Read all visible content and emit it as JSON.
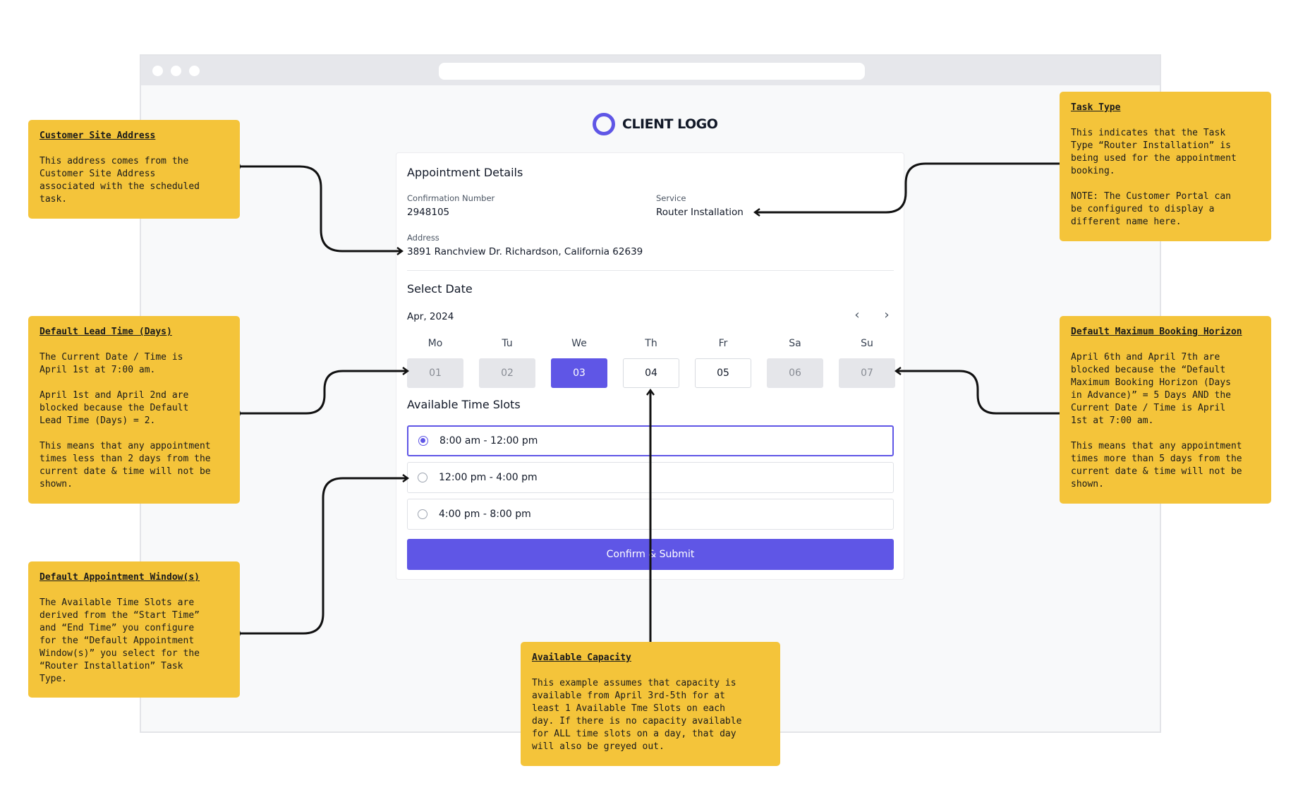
{
  "logo": {
    "text": "CLIENT LOGO",
    "accent": "#5f56e6"
  },
  "appointment": {
    "title": "Appointment Details",
    "confirmation_label": "Confirmation Number",
    "confirmation_value": "2948105",
    "service_label": "Service",
    "service_value": "Router Installation",
    "address_label": "Address",
    "address_value": "3891 Ranchview Dr. Richardson, California 62639"
  },
  "date_picker": {
    "title": "Select Date",
    "month": "Apr, 2024",
    "prev_icon": "chevron-left-icon",
    "next_icon": "chevron-right-icon",
    "days": [
      {
        "name": "Mo",
        "num": "01",
        "state": "disabled"
      },
      {
        "name": "Tu",
        "num": "02",
        "state": "disabled"
      },
      {
        "name": "We",
        "num": "03",
        "state": "selected"
      },
      {
        "name": "Th",
        "num": "04",
        "state": "available"
      },
      {
        "name": "Fr",
        "num": "05",
        "state": "available"
      },
      {
        "name": "Sa",
        "num": "06",
        "state": "disabled"
      },
      {
        "name": "Su",
        "num": "07",
        "state": "disabled"
      }
    ]
  },
  "time_slots": {
    "title": "Available Time Slots",
    "slots": [
      {
        "label": "8:00 am - 12:00 pm",
        "selected": true
      },
      {
        "label": "12:00 pm - 4:00 pm",
        "selected": false
      },
      {
        "label": "4:00 pm - 8:00 pm",
        "selected": false
      }
    ]
  },
  "submit_label": "Confirm & Submit",
  "colors": {
    "primary": "#5f56e6",
    "note": "#f4c43a",
    "disabled_day": "#e5e6ea"
  },
  "notes": {
    "customer_site_address": {
      "title": "Customer Site Address",
      "body": "This address comes from the\nCustomer Site Address\nassociated with the scheduled\ntask."
    },
    "default_lead_time": {
      "title": "Default Lead Time (Days)",
      "body": "The Current Date / Time is\nApril 1st at 7:00 am.\n\nApril 1st and April 2nd are\nblocked because the Default\nLead Time (Days) = 2.\n\nThis means that any appointment\ntimes less than 2 days from the\ncurrent date & time will not be\nshown."
    },
    "default_appointment_windows": {
      "title": "Default Appointment Window(s)",
      "body": "The Available Time Slots are\nderived from the “Start Time”\nand “End Time” you configure\nfor the “Default Appointment\nWindow(s)” you select for the\n“Router Installation” Task\nType."
    },
    "available_capacity": {
      "title": "Available Capacity",
      "body": "This example assumes that capacity is\navailable from April 3rd-5th for at\nleast 1 Available Tme Slots on each\nday. If there is no capacity available\nfor ALL time slots on a day, that day\nwill also be greyed out."
    },
    "task_type": {
      "title": "Task Type",
      "body": "This indicates that the Task\nType “Router Installation” is\nbeing used for the appointment\nbooking.\n\nNOTE: The Customer Portal can\nbe configured to display a\ndifferent name here."
    },
    "default_max_booking_horizon": {
      "title": "Default Maximum Booking Horizon",
      "body": "April 6th and April 7th are\nblocked because the “Default\nMaximum Booking Horizon (Days\nin Advance)” = 5 Days AND the\nCurrent Date / Time is April\n1st at 7:00 am.\n\nThis means that any appointment\ntimes more than 5 days from the\ncurrent date & time will not be\nshown."
    }
  }
}
